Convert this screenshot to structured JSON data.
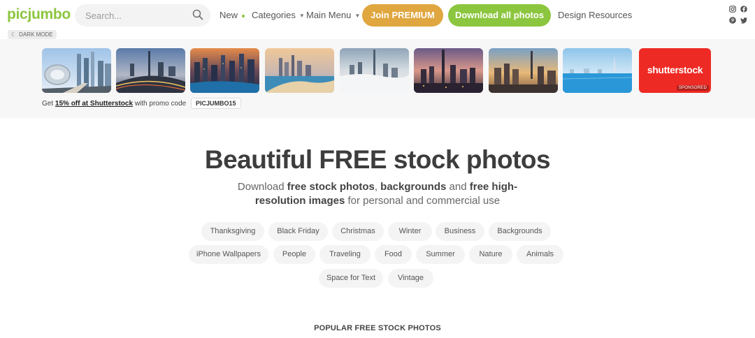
{
  "header": {
    "logo": "picjumbo",
    "search_placeholder": "Search...",
    "nav": {
      "new": "New",
      "categories": "Categories",
      "main_menu": "Main Menu",
      "join_premium": "Join PREMIUM",
      "download_all": "Download all photos",
      "design_resources": "Design Resources"
    },
    "social_icons": [
      "instagram-icon",
      "facebook-icon",
      "pinterest-icon",
      "twitter-icon"
    ],
    "dark_mode": "DARK MODE"
  },
  "strip": {
    "shutterstock_brand": "shutterstock",
    "sponsored": "SPONSORED",
    "promo_prefix": "Get",
    "promo_link": "15% off at Shutterstock",
    "promo_suffix": "with promo code",
    "promo_code": "PICJUMBO15"
  },
  "hero": {
    "title": "Beautiful FREE stock photos",
    "sub_1": "Download",
    "sub_b1": "free stock photos",
    "sub_2": ",",
    "sub_b2": "backgrounds",
    "sub_3": "and",
    "sub_b3": "free high-resolution images",
    "sub_4": "for personal and commercial use"
  },
  "tags": [
    "Thanksgiving",
    "Black Friday",
    "Christmas",
    "Winter",
    "Business",
    "Backgrounds",
    "iPhone Wallpapers",
    "People",
    "Traveling",
    "Food",
    "Summer",
    "Nature",
    "Animals",
    "Space for Text",
    "Vintage"
  ],
  "popular_heading": "POPULAR FREE STOCK PHOTOS",
  "colors": {
    "brand_green": "#8cc63f",
    "premium_orange": "#e0a63f",
    "shutterstock_red": "#ee2a24"
  }
}
